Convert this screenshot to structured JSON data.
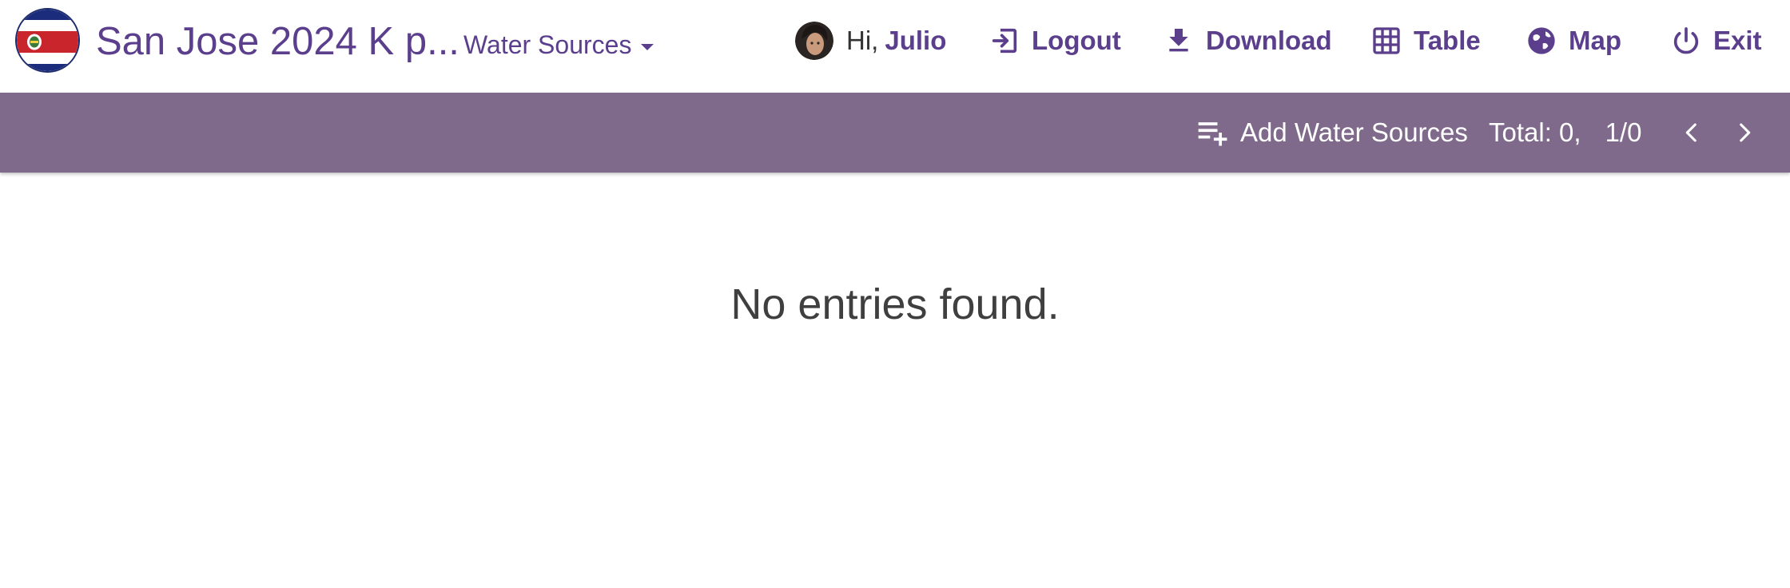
{
  "header": {
    "title": "San Jose 2024 K p...",
    "form_select": "Water Sources",
    "greeting_prefix": "Hi,",
    "user_name": "Julio",
    "nav": {
      "logout": "Logout",
      "download": "Download",
      "table": "Table",
      "map": "Map",
      "exit": "Exit"
    }
  },
  "toolbar": {
    "add_label": "Add Water Sources",
    "total_label": "Total: 0,",
    "page_label": "1/0"
  },
  "main": {
    "empty_message": "No entries found."
  },
  "icons": {
    "flag": "costa-rica-flag-icon",
    "logout": "logout-icon",
    "download": "download-icon",
    "table": "table-grid-icon",
    "map": "globe-icon",
    "exit": "power-icon",
    "add": "playlist-add-icon",
    "prev": "chevron-left-icon",
    "next": "chevron-right-icon"
  },
  "colors": {
    "brand": "#5b3f8c",
    "toolbar_bg": "#7f6a8c",
    "toolbar_text": "#ffffff",
    "empty_text": "#3f3f3f"
  }
}
